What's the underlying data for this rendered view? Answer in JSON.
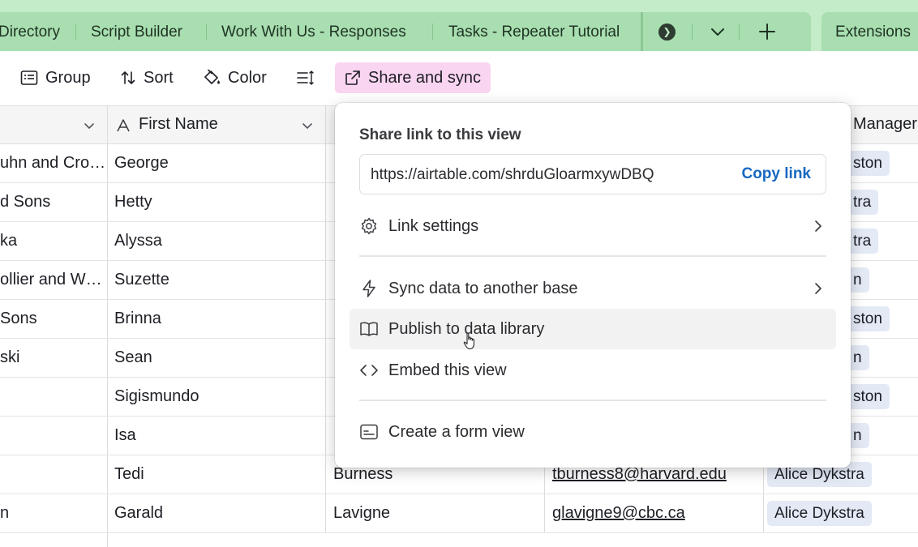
{
  "tabs": [
    {
      "label": "Directory"
    },
    {
      "label": "Script Builder"
    },
    {
      "label": "Work With Us - Responses"
    },
    {
      "label": "Tasks - Repeater Tutorial"
    }
  ],
  "extensions_label": "Extensions",
  "toolbar": {
    "group": "Group",
    "sort": "Sort",
    "color": "Color",
    "share": "Share and sync"
  },
  "columns": {
    "first_name": "First Name",
    "manager": "Manager"
  },
  "rows": [
    {
      "company": "uhn and Cro…",
      "first": "George",
      "last": "",
      "email": "",
      "manager": "ston"
    },
    {
      "company": "d Sons",
      "first": "Hetty",
      "last": "",
      "email": "",
      "manager": "tra"
    },
    {
      "company": "ka",
      "first": "Alyssa",
      "last": "",
      "email": "",
      "manager": "tra"
    },
    {
      "company": "ollier and W…",
      "first": "Suzette",
      "last": "",
      "email": "",
      "manager": "n"
    },
    {
      "company": "Sons",
      "first": "Brinna",
      "last": "",
      "email": "",
      "manager": "ston"
    },
    {
      "company": "ski",
      "first": "Sean",
      "last": "",
      "email": "",
      "manager": "n"
    },
    {
      "company": "",
      "first": "Sigismundo",
      "last": "",
      "email": "",
      "manager": "ston"
    },
    {
      "company": "",
      "first": "Isa",
      "last": "",
      "email": "",
      "manager": "n"
    },
    {
      "company": "",
      "first": "Tedi",
      "last": "Burness",
      "email": "tburness8@harvard.edu",
      "manager": "Alice Dykstra"
    },
    {
      "company": "n",
      "first": "Garald",
      "last": "Lavigne",
      "email": "glavigne9@cbc.ca",
      "manager": "Alice Dykstra"
    }
  ],
  "popup": {
    "title": "Share link to this view",
    "url": "https://airtable.com/shrduGloarmxywDBQ",
    "copy": "Copy link",
    "items": [
      {
        "label": "Link settings",
        "icon": "gear-icon"
      },
      {
        "label": "Sync data to another base",
        "icon": "lightning-icon"
      },
      {
        "label": "Publish to data library",
        "icon": "book-icon"
      },
      {
        "label": "Embed this view",
        "icon": "code-icon"
      },
      {
        "label": "Create a form view",
        "icon": "form-icon"
      }
    ]
  },
  "colors": {
    "tabbar_bg": "#c4ecc9",
    "share_bg": "#fad5f1",
    "copy_link": "#1769c1",
    "manager_badge": "#e3e9f5"
  }
}
